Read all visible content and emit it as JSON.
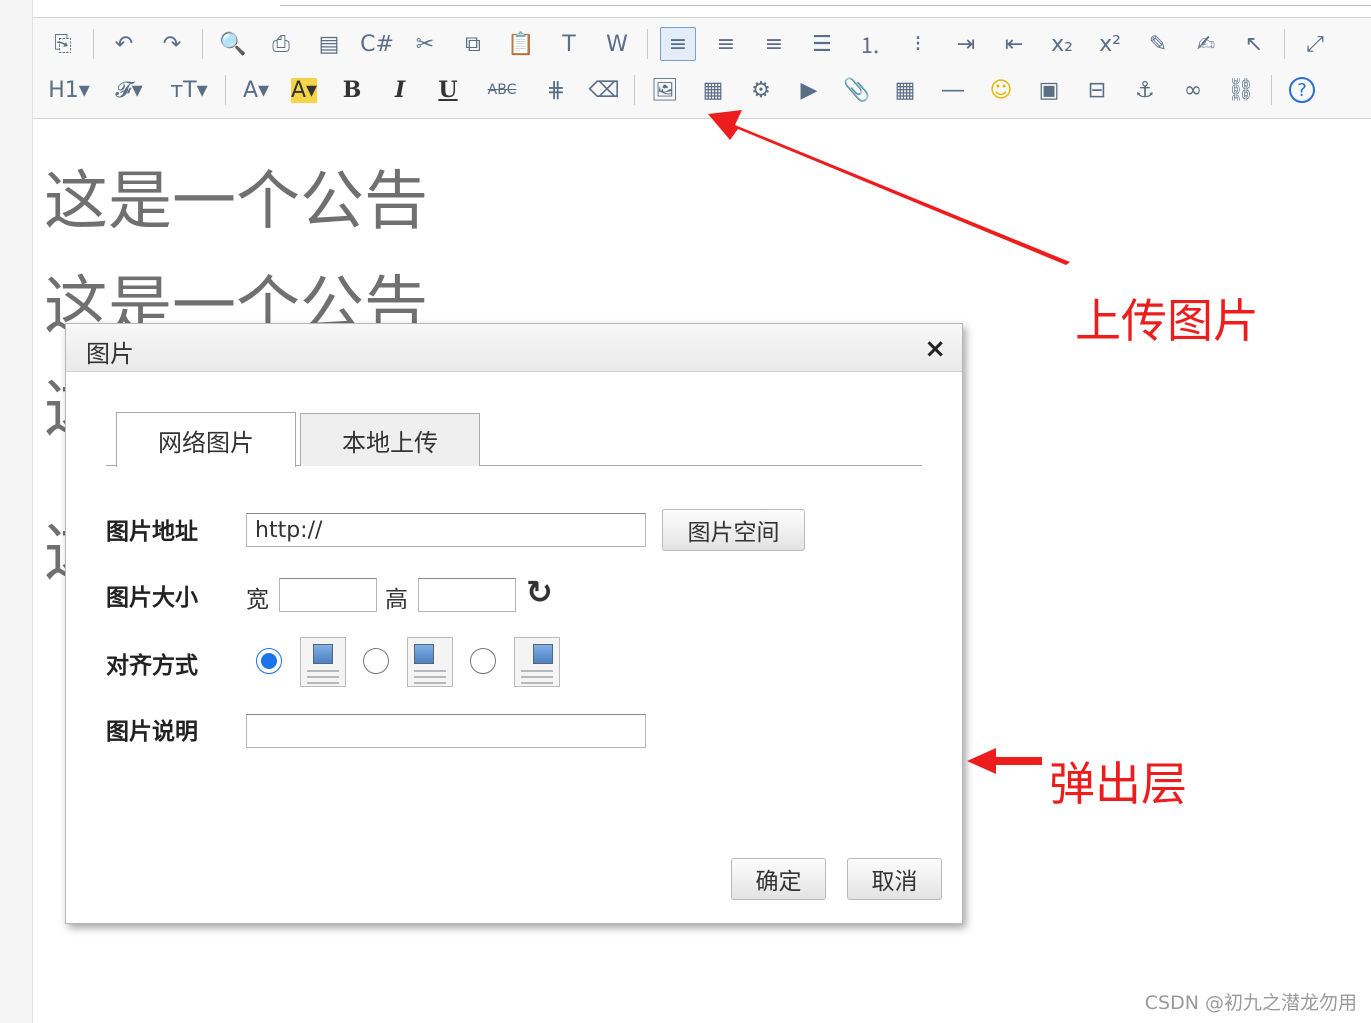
{
  "toolbar": {
    "row1": [
      {
        "name": "source-icon",
        "glyph": "⎘"
      },
      {
        "name": "undo-icon",
        "glyph": "↶"
      },
      {
        "name": "redo-icon",
        "glyph": "↷"
      },
      {
        "name": "preview-icon",
        "glyph": "🔍"
      },
      {
        "name": "print-icon",
        "glyph": "⎙"
      },
      {
        "name": "template-icon",
        "glyph": "▤"
      },
      {
        "name": "code-icon",
        "glyph": "C#"
      },
      {
        "name": "cut-icon",
        "glyph": "✂"
      },
      {
        "name": "copy-icon",
        "glyph": "⧉"
      },
      {
        "name": "paste-icon",
        "glyph": "📋"
      },
      {
        "name": "paste-text-icon",
        "glyph": "T"
      },
      {
        "name": "paste-word-icon",
        "glyph": "W"
      },
      {
        "name": "align-left-icon",
        "glyph": "≡",
        "active": true
      },
      {
        "name": "align-center-icon",
        "glyph": "≡"
      },
      {
        "name": "align-right-icon",
        "glyph": "≡"
      },
      {
        "name": "justify-icon",
        "glyph": "☰"
      },
      {
        "name": "ordered-list-icon",
        "glyph": "⒈"
      },
      {
        "name": "unordered-list-icon",
        "glyph": "⁝"
      },
      {
        "name": "indent-icon",
        "glyph": "⇥"
      },
      {
        "name": "outdent-icon",
        "glyph": "⇤"
      },
      {
        "name": "subscript-icon",
        "glyph": "x₂"
      },
      {
        "name": "superscript-icon",
        "glyph": "x²"
      },
      {
        "name": "clear-format-icon",
        "glyph": "✎"
      },
      {
        "name": "quick-format-icon",
        "glyph": "✍"
      },
      {
        "name": "select-all-icon",
        "glyph": "↖"
      },
      {
        "name": "fullscreen-icon",
        "glyph": "⤢"
      }
    ],
    "row2": [
      {
        "name": "heading-icon",
        "glyph": "H1▾"
      },
      {
        "name": "font-family-icon",
        "glyph": "𝓕▾"
      },
      {
        "name": "font-size-icon",
        "glyph": "тT▾"
      },
      {
        "name": "font-color-icon",
        "glyph": "A▾"
      },
      {
        "name": "highlight-icon",
        "glyph": "A▾"
      },
      {
        "name": "bold-icon",
        "glyph": "B"
      },
      {
        "name": "italic-icon",
        "glyph": "I"
      },
      {
        "name": "underline-icon",
        "glyph": "U"
      },
      {
        "name": "strikethrough-icon",
        "glyph": "ABC"
      },
      {
        "name": "line-height-icon",
        "glyph": "⋕"
      },
      {
        "name": "eraser-icon",
        "glyph": "⌫"
      },
      {
        "name": "image-upload-icon",
        "glyph": "🖼"
      },
      {
        "name": "multi-image-icon",
        "glyph": "▦"
      },
      {
        "name": "flash-icon",
        "glyph": "⚙"
      },
      {
        "name": "media-icon",
        "glyph": "▶"
      },
      {
        "name": "attachment-icon",
        "glyph": "📎"
      },
      {
        "name": "table-icon",
        "glyph": "▦"
      },
      {
        "name": "hr-icon",
        "glyph": "―"
      },
      {
        "name": "emoticon-icon",
        "glyph": "☺"
      },
      {
        "name": "map-icon",
        "glyph": "▣"
      },
      {
        "name": "pagebreak-icon",
        "glyph": "⊟"
      },
      {
        "name": "anchor-icon",
        "glyph": "⚓"
      },
      {
        "name": "link-icon",
        "glyph": "∞"
      },
      {
        "name": "unlink-icon",
        "glyph": "⛓"
      },
      {
        "name": "help-icon",
        "glyph": "?"
      }
    ]
  },
  "editor": {
    "lines": [
      "这是一个公告",
      "这是一个公告",
      "这",
      "这"
    ]
  },
  "dialog": {
    "title": "图片",
    "close_glyph": "×",
    "tabs": [
      {
        "label": "网络图片",
        "active": true
      },
      {
        "label": "本地上传",
        "active": false
      }
    ],
    "fields": {
      "url_label": "图片地址",
      "url_value": "http://",
      "space_button": "图片空间",
      "size_label": "图片大小",
      "width_label": "宽",
      "width_value": "",
      "height_label": "高",
      "height_value": "",
      "refresh_glyph": "↻",
      "align_label": "对齐方式",
      "align_selected": "left",
      "title_label": "图片说明",
      "title_value": ""
    },
    "buttons": {
      "ok": "确定",
      "cancel": "取消"
    }
  },
  "annotations": {
    "upload_image": "上传图片",
    "popup_layer": "弹出层",
    "color": "#ee1d1d"
  },
  "watermark": "CSDN @初九之潜龙勿用"
}
